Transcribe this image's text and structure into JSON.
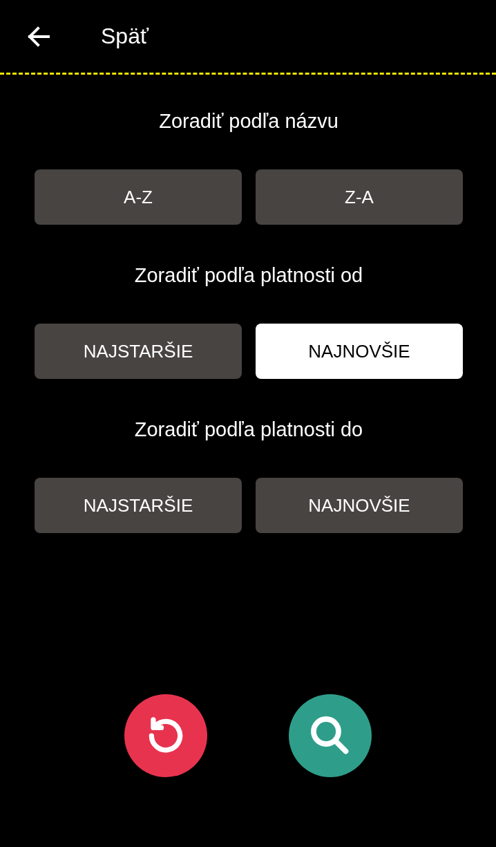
{
  "header": {
    "back_label": "Späť"
  },
  "sections": [
    {
      "title": "Zoradiť podľa názvu",
      "options": [
        {
          "label": "A-Z",
          "selected": false
        },
        {
          "label": "Z-A",
          "selected": false
        }
      ]
    },
    {
      "title": "Zoradiť podľa platnosti od",
      "options": [
        {
          "label": "NAJSTARŠIE",
          "selected": false
        },
        {
          "label": "NAJNOVŠIE",
          "selected": true
        }
      ]
    },
    {
      "title": "Zoradiť podľa platnosti do",
      "options": [
        {
          "label": "NAJSTARŠIE",
          "selected": false
        },
        {
          "label": "NAJNOVŠIE",
          "selected": false
        }
      ]
    }
  ],
  "actions": [
    {
      "kind": "reset"
    },
    {
      "kind": "search"
    }
  ]
}
